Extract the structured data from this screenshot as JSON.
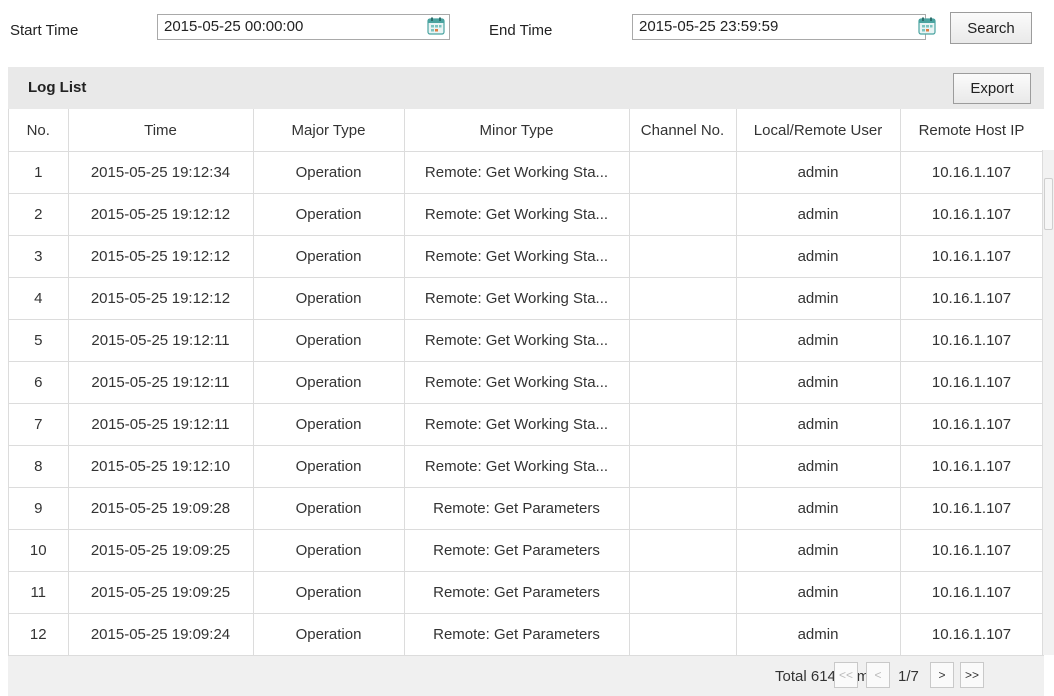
{
  "search": {
    "start_label": "Start Time",
    "start_value": "2015-05-25 00:00:00",
    "end_label": "End Time",
    "end_value": "2015-05-25 23:59:59",
    "search_button": "Search"
  },
  "log_list": {
    "title": "Log List",
    "export_button": "Export",
    "columns": [
      "No.",
      "Time",
      "Major Type",
      "Minor Type",
      "Channel No.",
      "Local/Remote User",
      "Remote Host IP"
    ],
    "rows": [
      {
        "no": "1",
        "time": "2015-05-25 19:12:34",
        "major": "Operation",
        "minor": "Remote: Get Working Sta...",
        "channel": "",
        "user": "admin",
        "ip": "10.16.1.107"
      },
      {
        "no": "2",
        "time": "2015-05-25 19:12:12",
        "major": "Operation",
        "minor": "Remote: Get Working Sta...",
        "channel": "",
        "user": "admin",
        "ip": "10.16.1.107"
      },
      {
        "no": "3",
        "time": "2015-05-25 19:12:12",
        "major": "Operation",
        "minor": "Remote: Get Working Sta...",
        "channel": "",
        "user": "admin",
        "ip": "10.16.1.107"
      },
      {
        "no": "4",
        "time": "2015-05-25 19:12:12",
        "major": "Operation",
        "minor": "Remote: Get Working Sta...",
        "channel": "",
        "user": "admin",
        "ip": "10.16.1.107"
      },
      {
        "no": "5",
        "time": "2015-05-25 19:12:11",
        "major": "Operation",
        "minor": "Remote: Get Working Sta...",
        "channel": "",
        "user": "admin",
        "ip": "10.16.1.107"
      },
      {
        "no": "6",
        "time": "2015-05-25 19:12:11",
        "major": "Operation",
        "minor": "Remote: Get Working Sta...",
        "channel": "",
        "user": "admin",
        "ip": "10.16.1.107"
      },
      {
        "no": "7",
        "time": "2015-05-25 19:12:11",
        "major": "Operation",
        "minor": "Remote: Get Working Sta...",
        "channel": "",
        "user": "admin",
        "ip": "10.16.1.107"
      },
      {
        "no": "8",
        "time": "2015-05-25 19:12:10",
        "major": "Operation",
        "minor": "Remote: Get Working Sta...",
        "channel": "",
        "user": "admin",
        "ip": "10.16.1.107"
      },
      {
        "no": "9",
        "time": "2015-05-25 19:09:28",
        "major": "Operation",
        "minor": "Remote: Get Parameters",
        "channel": "",
        "user": "admin",
        "ip": "10.16.1.107"
      },
      {
        "no": "10",
        "time": "2015-05-25 19:09:25",
        "major": "Operation",
        "minor": "Remote: Get Parameters",
        "channel": "",
        "user": "admin",
        "ip": "10.16.1.107"
      },
      {
        "no": "11",
        "time": "2015-05-25 19:09:25",
        "major": "Operation",
        "minor": "Remote: Get Parameters",
        "channel": "",
        "user": "admin",
        "ip": "10.16.1.107"
      },
      {
        "no": "12",
        "time": "2015-05-25 19:09:24",
        "major": "Operation",
        "minor": "Remote: Get Parameters",
        "channel": "",
        "user": "admin",
        "ip": "10.16.1.107"
      }
    ]
  },
  "pagination": {
    "total_text": "Total 614 Items",
    "first": "<<",
    "prev": "<",
    "page_indicator": "1/7",
    "next": ">",
    "last": ">>"
  },
  "icons": {
    "calendar": "calendar-icon"
  },
  "colors": {
    "header_bg": "#e9e9e9",
    "grid_line": "#dcdcdc",
    "calendar_teal": "#4aa3a0"
  }
}
